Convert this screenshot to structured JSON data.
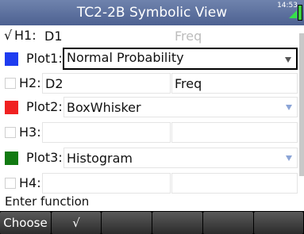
{
  "title": "TC2-2B Symbolic View",
  "clock": "14:53",
  "rows": {
    "h1": {
      "check": "√",
      "label": "H1:",
      "value": "D1",
      "freq": "Freq"
    },
    "plot1": {
      "label": "Plot1:",
      "value": "Normal Probability",
      "color": "#1e3cf0"
    },
    "h2": {
      "label": "H2:",
      "value": "D2",
      "freq": "Freq"
    },
    "plot2": {
      "label": "Plot2:",
      "value": "BoxWhisker",
      "color": "#f02121"
    },
    "h3": {
      "label": "H3:",
      "value": "",
      "freq": ""
    },
    "plot3": {
      "label": "Plot3:",
      "value": "Histogram",
      "color": "#127a12"
    },
    "h4": {
      "label": "H4:",
      "value": "",
      "freq": ""
    }
  },
  "status": "Enter function",
  "menu": [
    "Choose",
    "√",
    "",
    "",
    "",
    ""
  ]
}
